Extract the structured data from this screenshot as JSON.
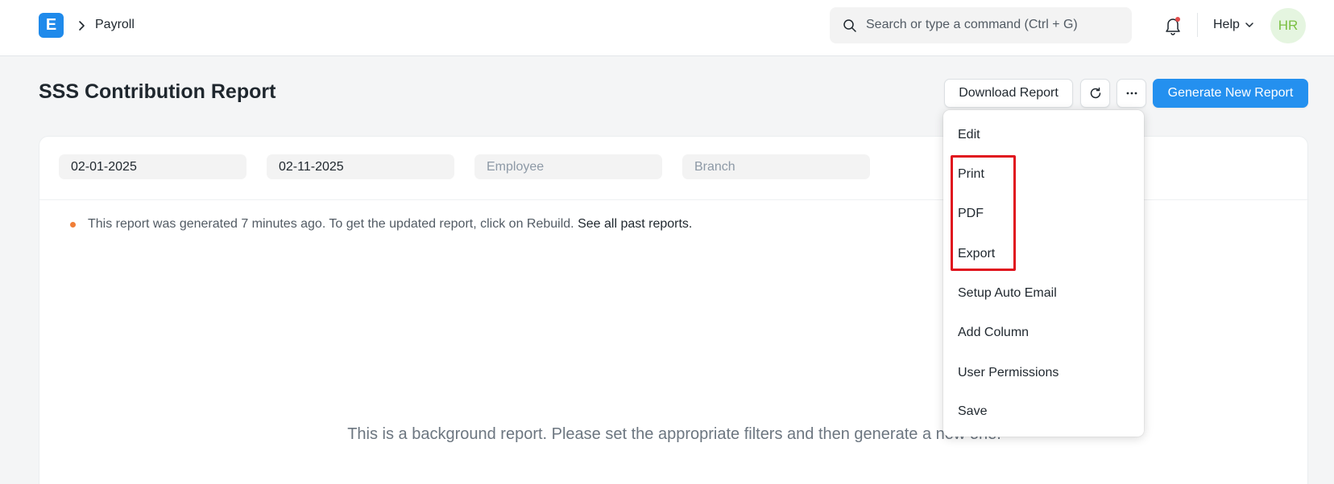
{
  "navbar": {
    "logo_letter": "E",
    "breadcrumb": "Payroll",
    "search_placeholder": "Search or type a command (Ctrl + G)",
    "help_label": "Help",
    "avatar_initials": "HR",
    "icons": [
      "chevron-right-icon",
      "search-icon",
      "bell-icon",
      "chevron-down-icon"
    ]
  },
  "page": {
    "title": "SSS Contribution Report",
    "buttons": {
      "download": "Download Report",
      "refresh_icon": "refresh-icon",
      "more_icon": "more-icon",
      "generate": "Generate New Report"
    }
  },
  "filters": {
    "from_date": "02-01-2025",
    "to_date": "02-11-2025",
    "employee_placeholder": "Employee",
    "branch_placeholder": "Branch"
  },
  "status": {
    "message": "This report was generated 7 minutes ago. To get the updated report, click on Rebuild.",
    "link": "See all past reports."
  },
  "empty_state": "This is a background report. Please set the appropriate filters and then generate a new one.",
  "menu": {
    "items": [
      "Edit",
      "Print",
      "PDF",
      "Export",
      "Setup Auto Email",
      "Add Column",
      "User Permissions",
      "Save"
    ],
    "highlighted": [
      "Print",
      "PDF",
      "Export"
    ]
  },
  "colors": {
    "primary": "#2490ef",
    "logo": "#1f8aeb",
    "highlight_box": "#e0141e",
    "status_dot": "#f07e37",
    "avatar_bg": "#e5f5e0",
    "avatar_text": "#7bc043"
  }
}
